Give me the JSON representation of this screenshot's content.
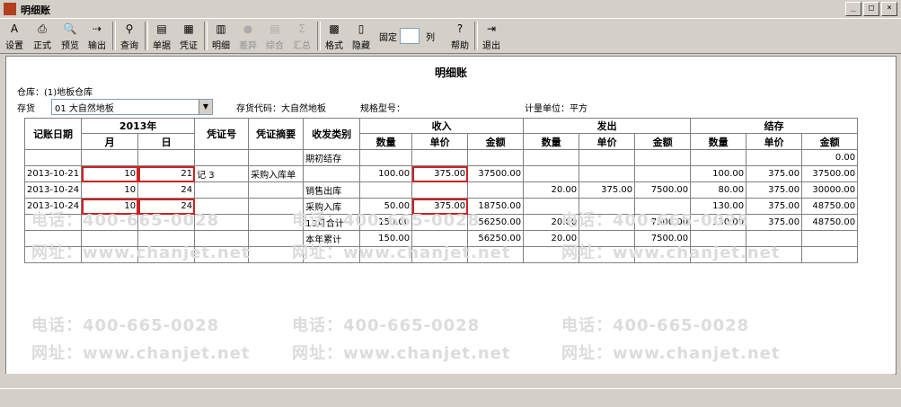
{
  "window": {
    "title": "明细账",
    "controls": [
      "minimize",
      "restore",
      "close"
    ]
  },
  "toolbar": {
    "buttons": [
      {
        "label": "设置",
        "icon": "settings-icon",
        "glyph": "A",
        "enabled": true
      },
      {
        "label": "正式",
        "icon": "printer-icon",
        "glyph": "⎙",
        "enabled": true
      },
      {
        "label": "预览",
        "icon": "preview-icon",
        "glyph": "🔍",
        "enabled": true
      },
      {
        "label": "输出",
        "icon": "export-icon",
        "glyph": "⇢",
        "enabled": true
      },
      {
        "label": "查询",
        "icon": "binoculars-icon",
        "glyph": "⚲",
        "enabled": true
      },
      {
        "label": "单据",
        "icon": "document-icon",
        "glyph": "▤",
        "enabled": true
      },
      {
        "label": "凭证",
        "icon": "voucher-icon",
        "glyph": "▦",
        "enabled": true
      },
      {
        "label": "明细",
        "icon": "detail-icon",
        "glyph": "▥",
        "enabled": true
      },
      {
        "label": "差异",
        "icon": "diff-icon",
        "glyph": "●",
        "enabled": false
      },
      {
        "label": "综合",
        "icon": "summary-icon",
        "glyph": "▤",
        "enabled": false
      },
      {
        "label": "汇总",
        "icon": "sum-icon",
        "glyph": "Σ",
        "enabled": false
      },
      {
        "label": "格式",
        "icon": "format-icon",
        "glyph": "▩",
        "enabled": true
      },
      {
        "label": "隐藏",
        "icon": "hide-icon",
        "glyph": "▯",
        "enabled": true
      },
      {
        "label": "帮助",
        "icon": "help-icon",
        "glyph": "?",
        "enabled": true
      },
      {
        "label": "退出",
        "icon": "exit-icon",
        "glyph": "⇥",
        "enabled": true
      }
    ],
    "fixed_label": "固定",
    "fixed_value": "",
    "col_label": "列"
  },
  "report": {
    "title": "明细账",
    "warehouse": "仓库：(1)地板仓库",
    "item_label": "存货",
    "item_value": "01 大自然地板",
    "code": "存货代码：大自然地板",
    "spec": "规格型号：",
    "unit": "计量单位：平方"
  },
  "table": {
    "headers": {
      "date": "记账日期",
      "year": "2013年",
      "month": "月",
      "day": "日",
      "voucher": "凭证号",
      "summary": "凭证摘要",
      "category": "收发类别",
      "in": "收入",
      "out": "发出",
      "balance": "结存",
      "qty": "数量",
      "price": "单价",
      "amount": "金额"
    },
    "rows": [
      [
        "",
        "",
        "",
        "",
        "",
        "期初结存",
        "",
        "",
        "",
        "",
        "",
        "",
        "",
        "",
        "0.00"
      ],
      [
        "2013-10-21",
        "10",
        "21",
        "记 3",
        "采购入库单",
        "",
        "100.00",
        "375.00",
        "37500.00",
        "",
        "",
        "",
        "100.00",
        "375.00",
        "37500.00"
      ],
      [
        "2013-10-24",
        "10",
        "24",
        "",
        "",
        "销售出库",
        "",
        "",
        "",
        "20.00",
        "375.00",
        "7500.00",
        "80.00",
        "375.00",
        "30000.00"
      ],
      [
        "2013-10-24",
        "10",
        "24",
        "",
        "",
        "采购入库",
        "50.00",
        "375.00",
        "18750.00",
        "",
        "",
        "",
        "130.00",
        "375.00",
        "48750.00"
      ],
      [
        "",
        "",
        "",
        "",
        "",
        "10月合计",
        "150.00",
        "",
        "56250.00",
        "20.00",
        "",
        "7500.00",
        "130.00",
        "375.00",
        "48750.00"
      ],
      [
        "",
        "",
        "",
        "",
        "",
        "本年累计",
        "150.00",
        "",
        "56250.00",
        "20.00",
        "",
        "7500.00",
        "",
        "",
        ""
      ]
    ]
  },
  "watermark": {
    "phone": "电话：400-665-0028",
    "site": "网址：www.chanjet.net"
  }
}
